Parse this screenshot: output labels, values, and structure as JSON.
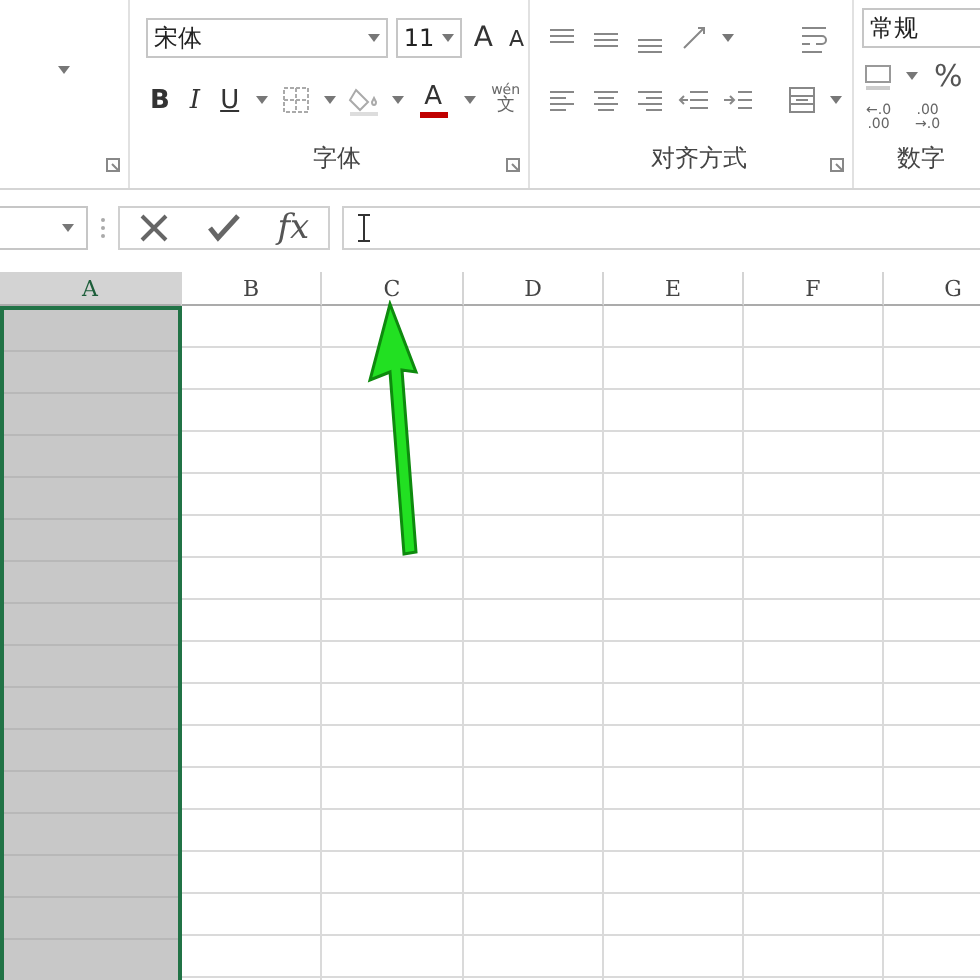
{
  "ribbon": {
    "font_group": {
      "font_name": "宋体",
      "font_size": "11",
      "grow_glyph": "A",
      "shrink_glyph": "A",
      "bold": "B",
      "italic": "I",
      "underline": "U",
      "font_color_glyph": "A",
      "phonetic_top": "wén",
      "phonetic_bottom": "文",
      "label": "字体"
    },
    "alignment_group": {
      "label": "对齐方式"
    },
    "number_group": {
      "format": "常规",
      "percent": "%",
      "decimal_increase": {
        "top": "←.0",
        "bottom": ".00"
      },
      "decimal_decrease": {
        "top": ".00",
        "bottom": "→.0"
      },
      "label": "数字"
    }
  },
  "formula_bar": {
    "function_label": "fx"
  },
  "sheet": {
    "columns": [
      {
        "label": "A",
        "selected": true
      },
      {
        "label": "B",
        "selected": false
      },
      {
        "label": "C",
        "selected": false
      },
      {
        "label": "D",
        "selected": false
      },
      {
        "label": "E",
        "selected": false
      },
      {
        "label": "F",
        "selected": false
      },
      {
        "label": "G",
        "selected": false
      }
    ]
  }
}
